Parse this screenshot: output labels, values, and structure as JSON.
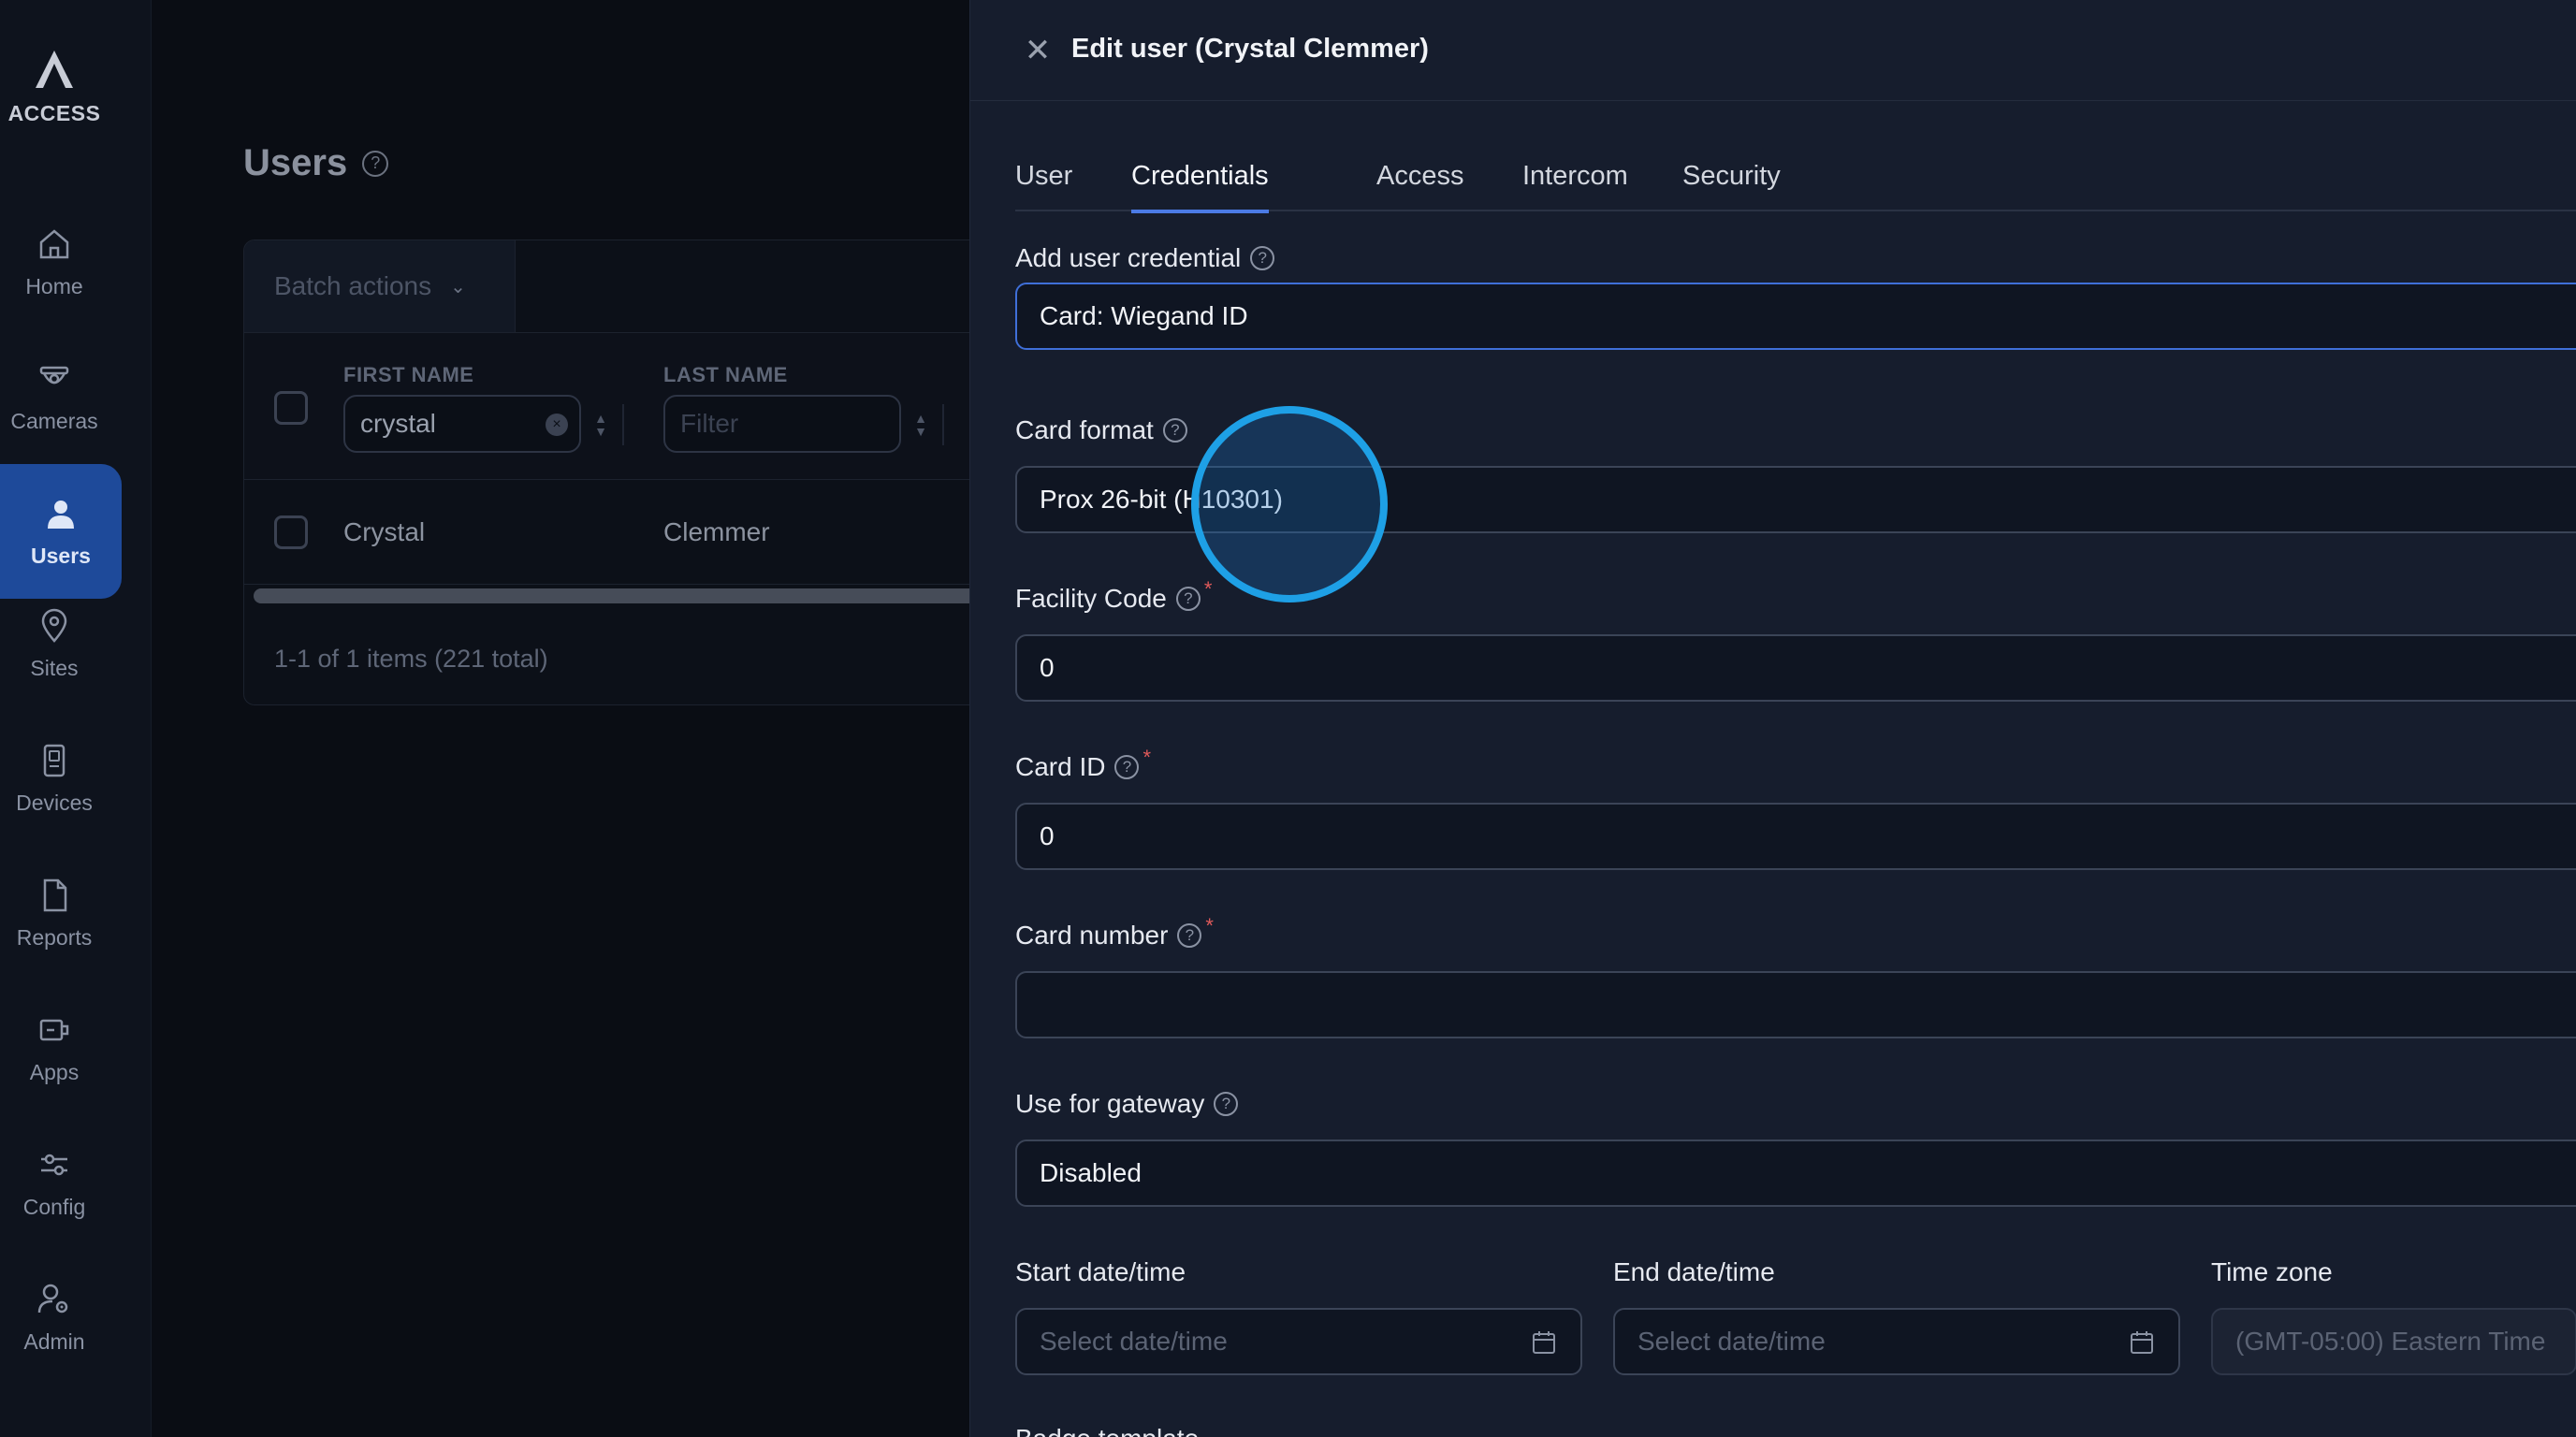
{
  "nav": {
    "brand": "ACCESS",
    "items": [
      {
        "label": "Home",
        "icon": "home-icon"
      },
      {
        "label": "Cameras",
        "icon": "camera-icon"
      },
      {
        "label": "Users",
        "icon": "user-icon",
        "active": true
      },
      {
        "label": "Sites",
        "icon": "map-pin-icon"
      },
      {
        "label": "Devices",
        "icon": "device-icon"
      },
      {
        "label": "Reports",
        "icon": "document-icon"
      },
      {
        "label": "Apps",
        "icon": "apps-icon"
      },
      {
        "label": "Config",
        "icon": "sliders-icon"
      },
      {
        "label": "Admin",
        "icon": "user-gear-icon"
      }
    ]
  },
  "users_page": {
    "title": "Users",
    "batch_actions": "Batch actions",
    "columns": {
      "first_name": "FIRST NAME",
      "last_name": "LAST NAME"
    },
    "filters": {
      "first_name_value": "crystal",
      "last_name_placeholder": "Filter"
    },
    "rows": [
      {
        "first_name": "Crystal",
        "last_name": "Clemmer"
      }
    ],
    "pager": "1-1 of 1 items (221 total)"
  },
  "drawer": {
    "title": "Edit user (Crystal Clemmer)",
    "tabs": [
      "User",
      "Credentials",
      "Access",
      "Intercom",
      "Security"
    ],
    "active_tab": "Credentials",
    "fields": {
      "add_credential": {
        "label": "Add user credential",
        "value": "Card: Wiegand ID"
      },
      "card_format": {
        "label": "Card format",
        "value": "Prox 26-bit (H10301)"
      },
      "facility_code": {
        "label": "Facility Code",
        "value": "0"
      },
      "card_id": {
        "label": "Card ID",
        "value": "0"
      },
      "card_number": {
        "label": "Card number",
        "value": ""
      },
      "gateway": {
        "label": "Use for gateway",
        "value": "Disabled"
      },
      "start_date": {
        "label": "Start date/time",
        "placeholder": "Select date/time"
      },
      "end_date": {
        "label": "End date/time",
        "placeholder": "Select date/time"
      },
      "time_zone": {
        "label": "Time zone",
        "value": "(GMT-05:00) Eastern Time"
      },
      "cut_off_label": "Badge template"
    }
  },
  "colors": {
    "accent": "#4b7be5",
    "nav_active": "#1e4a9a",
    "cursor_ring": "#1ea0e6",
    "required": "#e05a5a"
  }
}
